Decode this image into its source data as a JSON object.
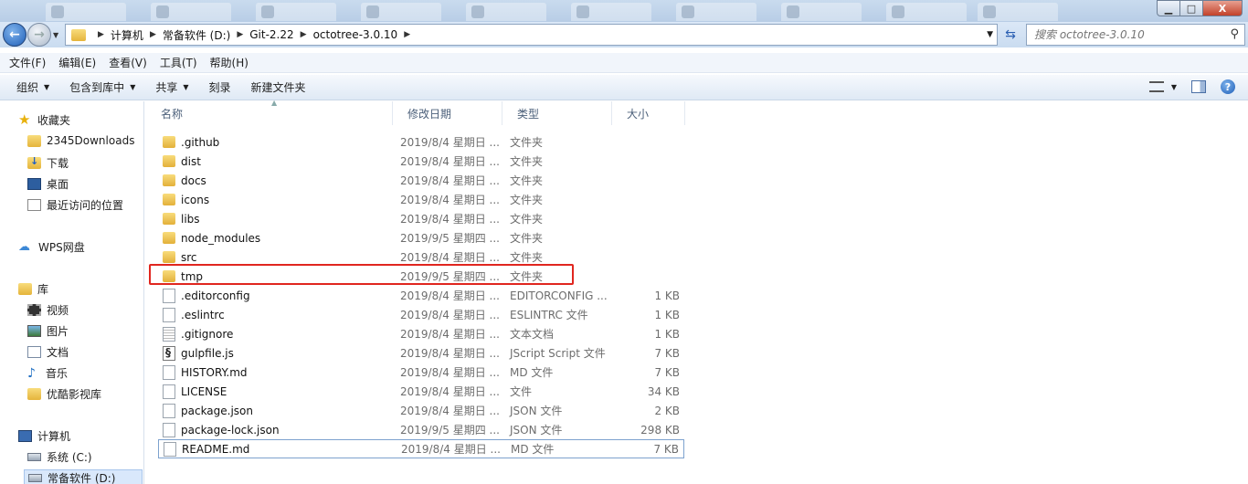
{
  "window": {
    "minimize": "▁",
    "maximize": "□",
    "close": "X"
  },
  "nav": {
    "back_icon": "←",
    "forward_icon": "→",
    "breadcrumbs": [
      "计算机",
      "常备软件 (D:)",
      "Git-2.22",
      "octotree-3.0.10"
    ],
    "search_placeholder": "搜索 octotree-3.0.10"
  },
  "menu": [
    "文件(F)",
    "编辑(E)",
    "查看(V)",
    "工具(T)",
    "帮助(H)"
  ],
  "toolbar": [
    "组织",
    "包含到库中",
    "共享",
    "刻录",
    "新建文件夹"
  ],
  "sidebar": {
    "favorites": {
      "label": "收藏夹",
      "items": [
        "2345Downloads",
        "下载",
        "桌面",
        "最近访问的位置"
      ]
    },
    "cloud": {
      "label": "WPS网盘"
    },
    "libraries": {
      "label": "库",
      "items": [
        "视频",
        "图片",
        "文档",
        "音乐",
        "优酷影视库"
      ]
    },
    "computer": {
      "label": "计算机",
      "items": [
        "系统 (C:)",
        "常备软件 (D:)"
      ]
    }
  },
  "columns": {
    "name": "名称",
    "date": "修改日期",
    "type": "类型",
    "size": "大小"
  },
  "files": [
    {
      "name": ".github",
      "date": "2019/8/4 星期日 ...",
      "type": "文件夹",
      "size": "",
      "icon": "folder"
    },
    {
      "name": "dist",
      "date": "2019/8/4 星期日 ...",
      "type": "文件夹",
      "size": "",
      "icon": "folder"
    },
    {
      "name": "docs",
      "date": "2019/8/4 星期日 ...",
      "type": "文件夹",
      "size": "",
      "icon": "folder"
    },
    {
      "name": "icons",
      "date": "2019/8/4 星期日 ...",
      "type": "文件夹",
      "size": "",
      "icon": "folder"
    },
    {
      "name": "libs",
      "date": "2019/8/4 星期日 ...",
      "type": "文件夹",
      "size": "",
      "icon": "folder"
    },
    {
      "name": "node_modules",
      "date": "2019/9/5 星期四 ...",
      "type": "文件夹",
      "size": "",
      "icon": "folder"
    },
    {
      "name": "src",
      "date": "2019/8/4 星期日 ...",
      "type": "文件夹",
      "size": "",
      "icon": "folder"
    },
    {
      "name": "tmp",
      "date": "2019/9/5 星期四 ...",
      "type": "文件夹",
      "size": "",
      "icon": "folder"
    },
    {
      "name": ".editorconfig",
      "date": "2019/8/4 星期日 ...",
      "type": "EDITORCONFIG ...",
      "size": "1 KB",
      "icon": "file"
    },
    {
      "name": ".eslintrc",
      "date": "2019/8/4 星期日 ...",
      "type": "ESLINTRC 文件",
      "size": "1 KB",
      "icon": "file"
    },
    {
      "name": ".gitignore",
      "date": "2019/8/4 星期日 ...",
      "type": "文本文档",
      "size": "1 KB",
      "icon": "text"
    },
    {
      "name": "gulpfile.js",
      "date": "2019/8/4 星期日 ...",
      "type": "JScript Script 文件",
      "size": "7 KB",
      "icon": "js"
    },
    {
      "name": "HISTORY.md",
      "date": "2019/8/4 星期日 ...",
      "type": "MD 文件",
      "size": "7 KB",
      "icon": "file"
    },
    {
      "name": "LICENSE",
      "date": "2019/8/4 星期日 ...",
      "type": "文件",
      "size": "34 KB",
      "icon": "file"
    },
    {
      "name": "package.json",
      "date": "2019/8/4 星期日 ...",
      "type": "JSON 文件",
      "size": "2 KB",
      "icon": "file"
    },
    {
      "name": "package-lock.json",
      "date": "2019/9/5 星期四 ...",
      "type": "JSON 文件",
      "size": "298 KB",
      "icon": "file"
    },
    {
      "name": "README.md",
      "date": "2019/8/4 星期日 ...",
      "type": "MD 文件",
      "size": "7 KB",
      "icon": "file"
    }
  ],
  "highlight_color": "#e0261f"
}
